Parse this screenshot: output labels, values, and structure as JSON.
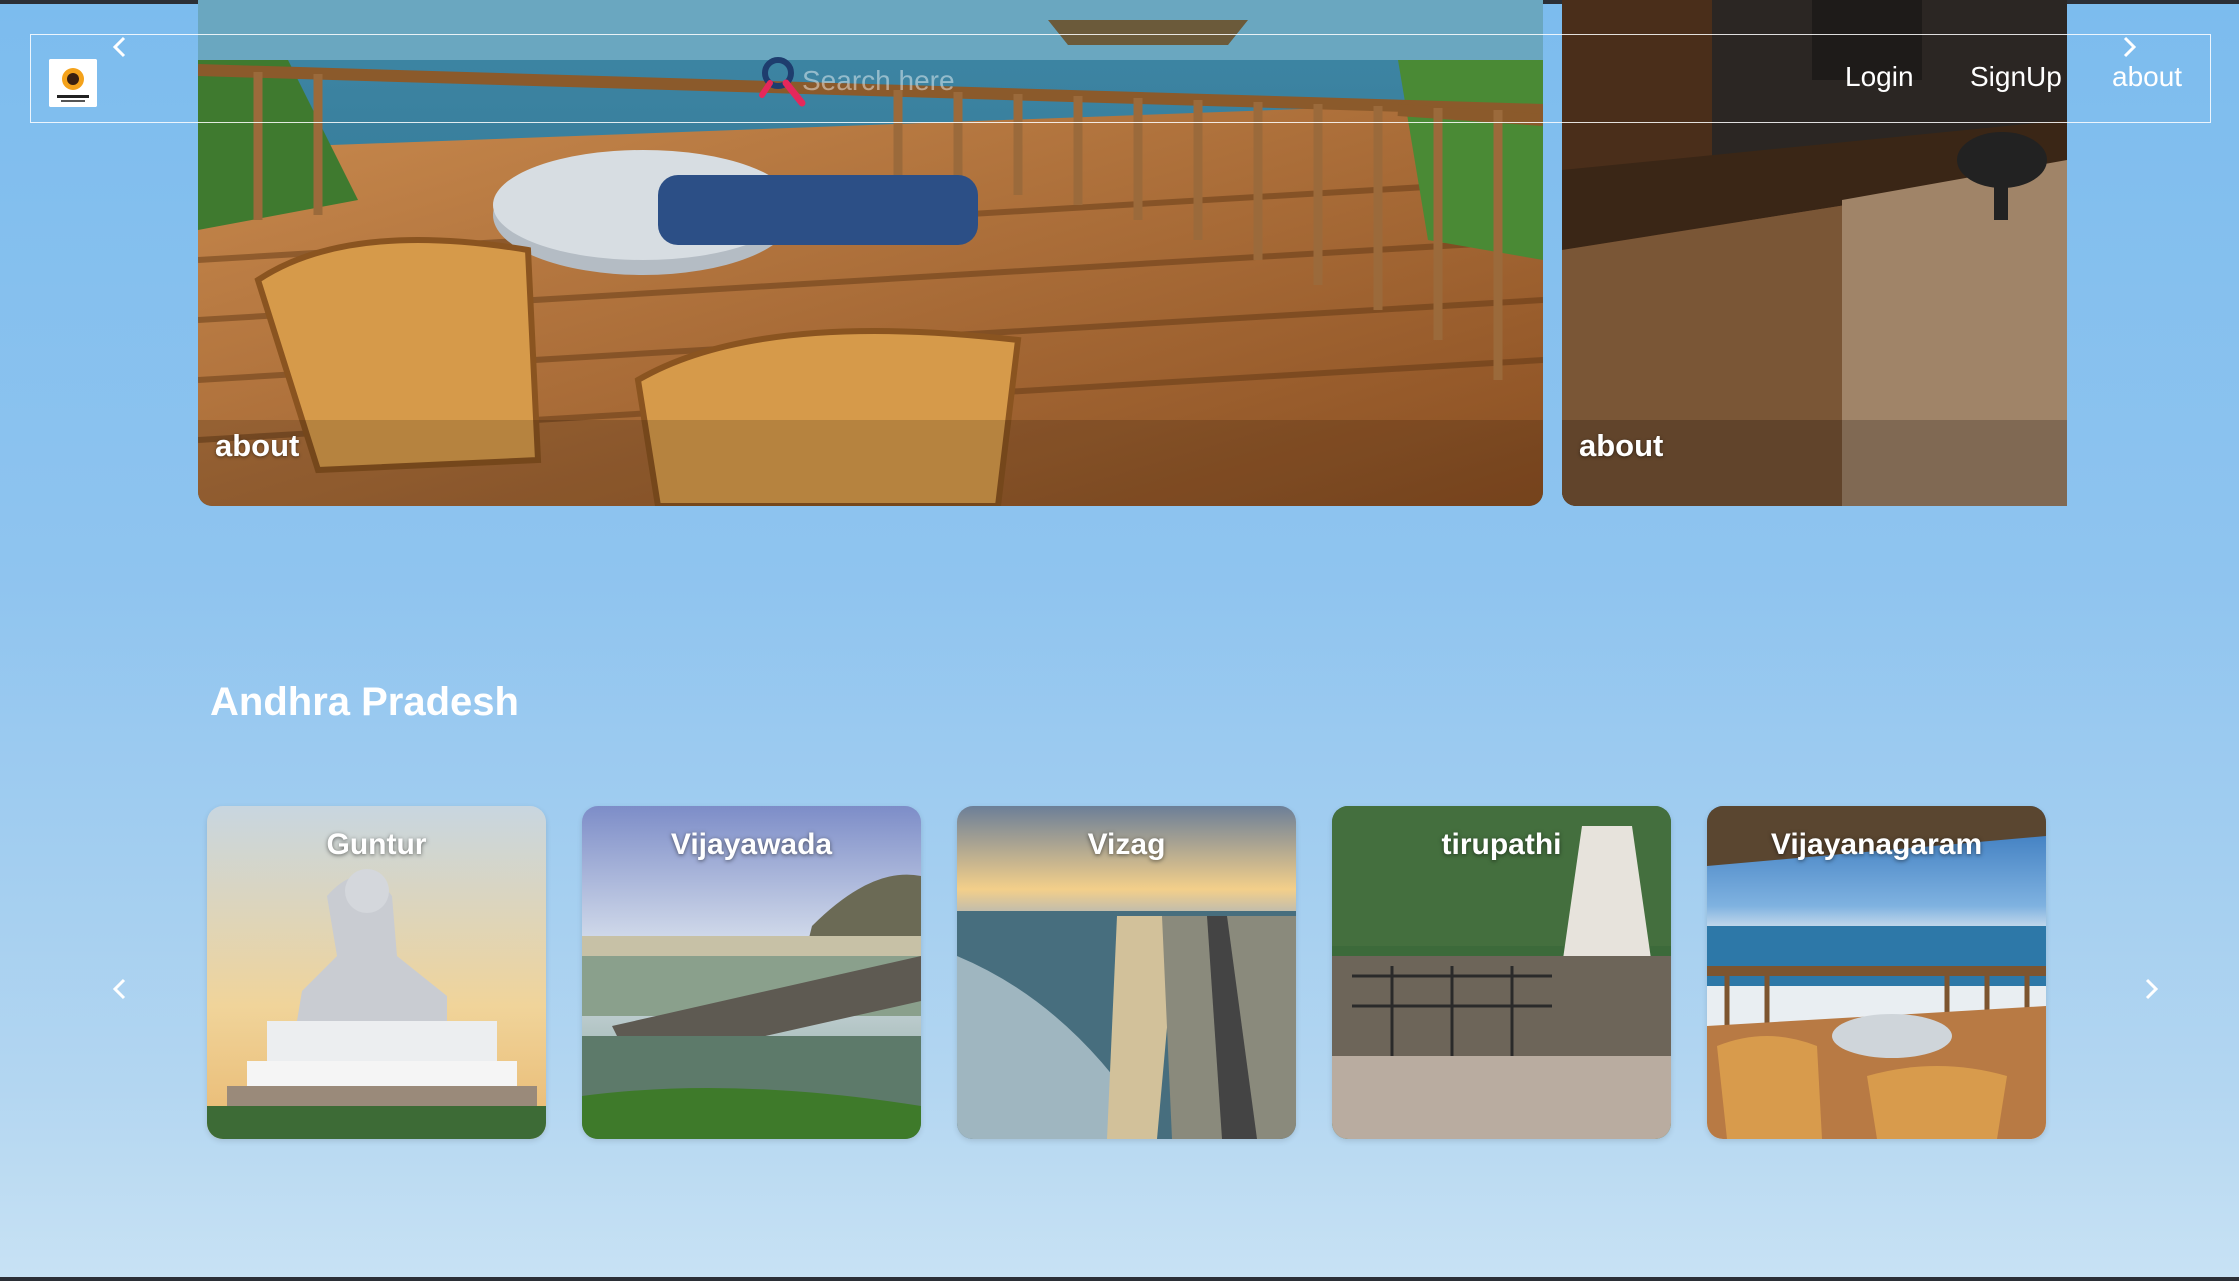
{
  "hero": {
    "slides": [
      {
        "label": "about",
        "scene": "wooden deck with bamboo chairs overlooking sea"
      },
      {
        "label": "about",
        "scene": "hotel room interior with desk"
      }
    ]
  },
  "navbar": {
    "search_placeholder": "Search here",
    "links": {
      "login": "Login",
      "signup": "SignUp",
      "about": "about"
    }
  },
  "section": {
    "title": "Andhra Pradesh",
    "cards": [
      {
        "label": "Guntur"
      },
      {
        "label": "Vijayawada"
      },
      {
        "label": "Vizag"
      },
      {
        "label": "tirupathi"
      },
      {
        "label": "Vijayanagaram"
      }
    ]
  },
  "colors": {
    "background_top": "#7cbcee",
    "background_bottom": "#c8e2f4",
    "text": "#ffffff"
  }
}
